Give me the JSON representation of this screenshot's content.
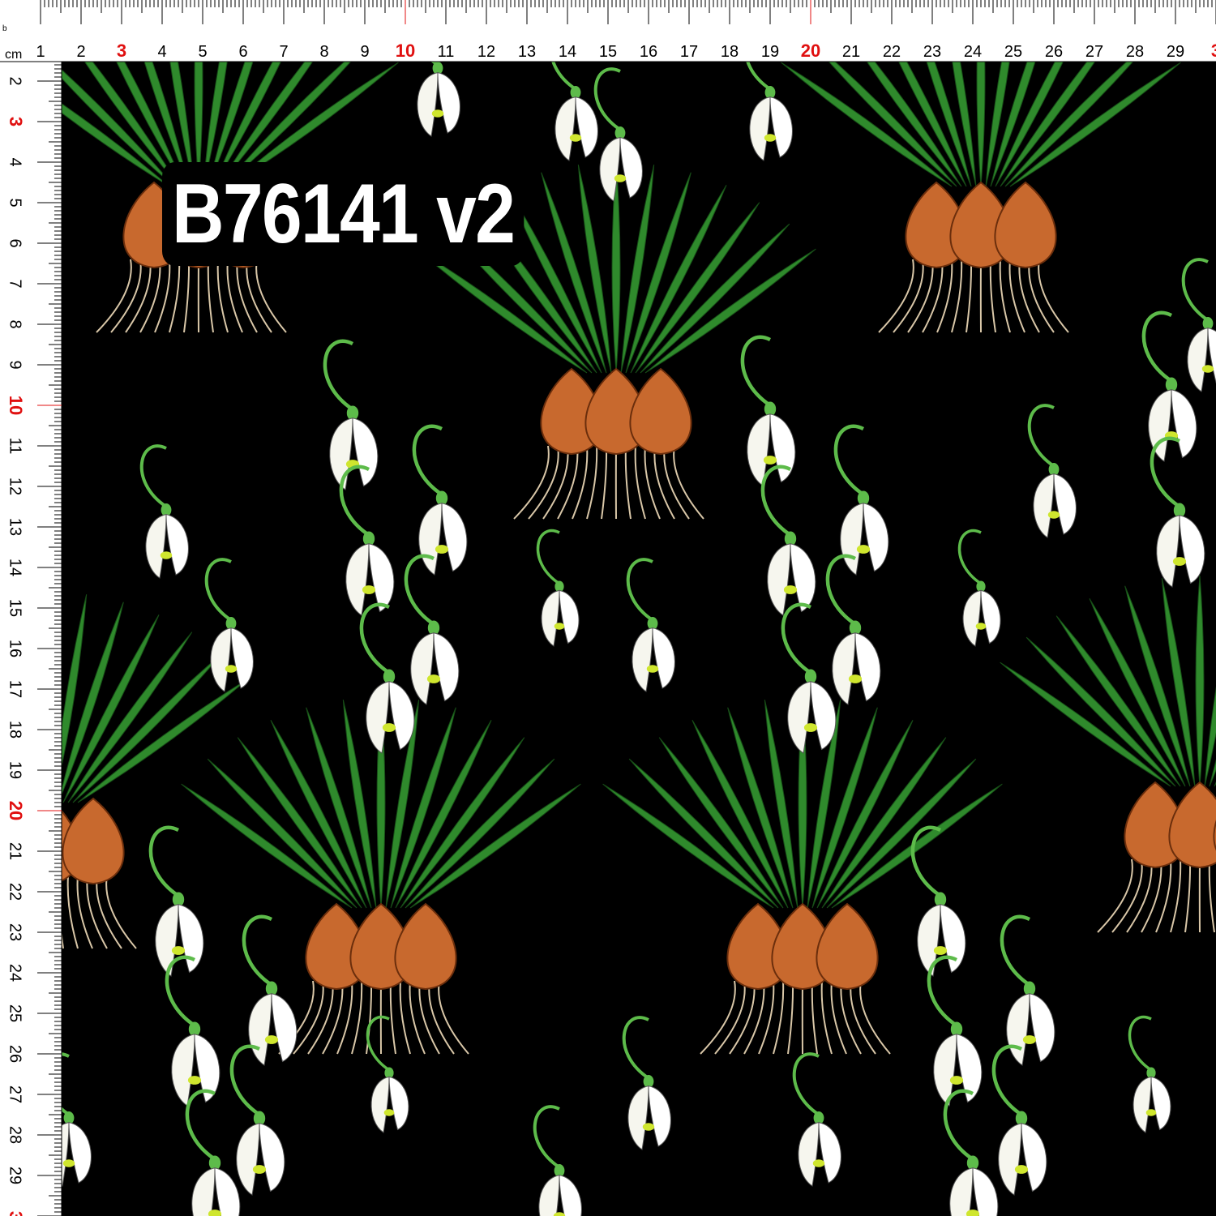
{
  "ruler": {
    "unit_label": "cm",
    "corner_label": "b",
    "top_numbers": [
      "1",
      "2",
      "3",
      "4",
      "5",
      "6",
      "7",
      "8",
      "9",
      "10",
      "11",
      "12",
      "13",
      "14",
      "15",
      "16",
      "17",
      "18",
      "19",
      "20",
      "21",
      "22",
      "23",
      "24",
      "25",
      "26",
      "27",
      "28",
      "29",
      "3"
    ],
    "left_numbers": [
      "2",
      "3",
      "4",
      "5",
      "6",
      "7",
      "8",
      "9",
      "10",
      "11",
      "12",
      "13",
      "14",
      "15",
      "16",
      "17",
      "18",
      "19",
      "20",
      "21",
      "22",
      "23",
      "24",
      "25",
      "26",
      "27",
      "28",
      "29",
      "3"
    ],
    "highlight_numbers": [
      "10",
      "20",
      "3"
    ],
    "highlight_color": "#e01010",
    "text_color": "#000000"
  },
  "fabric": {
    "background_color": "#000000",
    "petal_color": "#f6f6ee",
    "petal_mark_color": "#cfe62e",
    "stem_color": "#5dbb4a",
    "leaf_color": "#2f8a2c",
    "bulb_color": "#c8692e",
    "root_color": "#d9c7a8"
  },
  "design_code": "B76141 v2"
}
